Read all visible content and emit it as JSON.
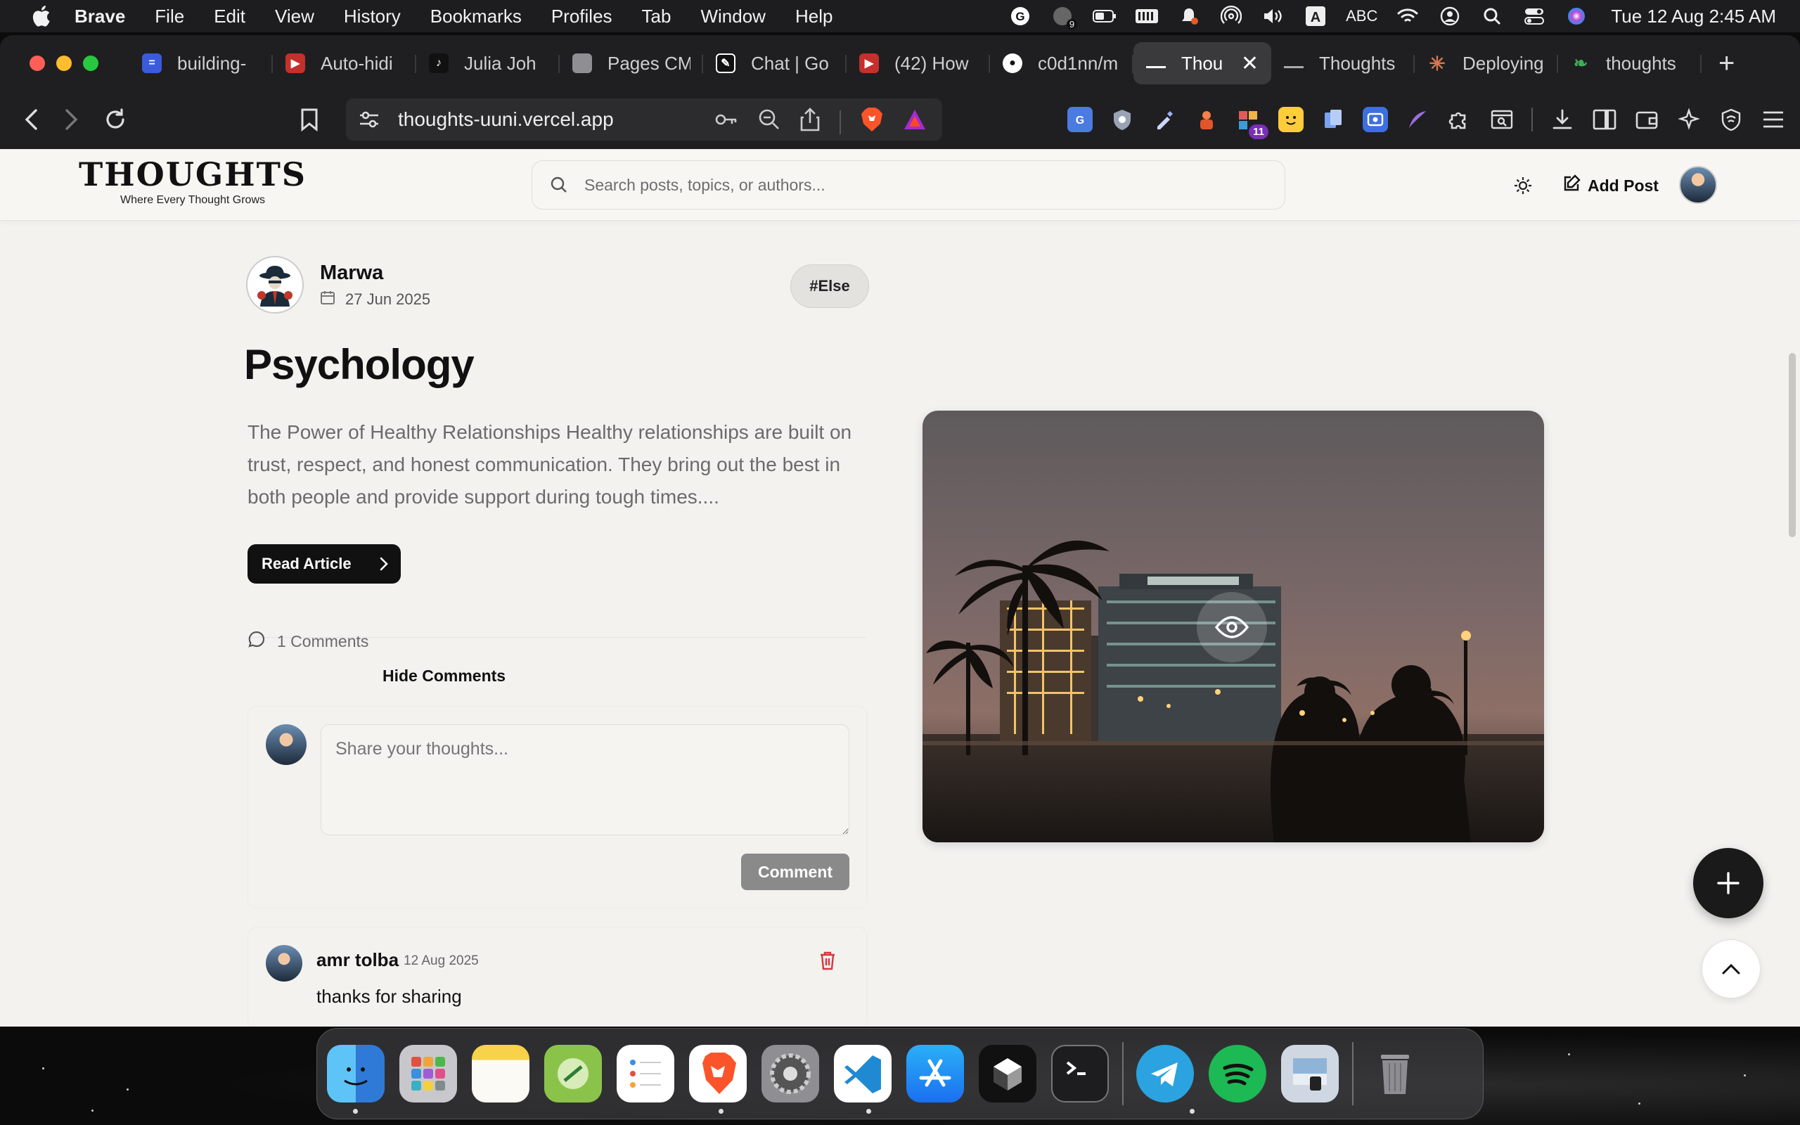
{
  "menubar": {
    "app_name": "Brave",
    "menus": [
      "File",
      "Edit",
      "View",
      "History",
      "Bookmarks",
      "Profiles",
      "Tab",
      "Window",
      "Help"
    ],
    "status": {
      "notifications_badge": "9",
      "input_source": "ABC",
      "clock": "Tue 12 Aug  2:45 AM"
    }
  },
  "tabs": [
    {
      "title": "building-",
      "favicon_color": "#3b5bdb"
    },
    {
      "title": "Auto-hidi",
      "favicon_color": "#c4302b"
    },
    {
      "title": "Julia Joh",
      "favicon_color": "#111111"
    },
    {
      "title": "Pages CM",
      "favicon_color": "#8e8e93"
    },
    {
      "title": "Chat | Go",
      "favicon_color": "#111111"
    },
    {
      "title": "(42) How",
      "favicon_color": "#c4302b"
    },
    {
      "title": "c0d1nn/m",
      "favicon_color": "#111111"
    },
    {
      "title": "Thou",
      "favicon_color": "#111111",
      "active": true
    },
    {
      "title": "Thoughts",
      "favicon_color": "#111111"
    },
    {
      "title": "Deploying",
      "favicon_color": "#d9774f"
    },
    {
      "title": "thoughts",
      "favicon_color": "#3fae5a"
    }
  ],
  "address_bar": {
    "url": "thoughts-uuni.vercel.app"
  },
  "extensions": {
    "badge_count": "11"
  },
  "site": {
    "logo_title": "THOUGHTS",
    "logo_subtitle": "Where Every Thought Grows",
    "search_placeholder": "Search posts, topics, or authors...",
    "add_post_label": "Add Post"
  },
  "post": {
    "author": "Marwa",
    "date": "27 Jun 2025",
    "tag": "#Else",
    "title": "Psychology",
    "excerpt": "The Power of Healthy Relationships Healthy relationships are built on trust, respect, and honest communication. They bring out the best in both people and provide support during tough times....",
    "read_label": "Read Article",
    "comment_count": "1 Comments",
    "hide_comments_label": "Hide Comments",
    "comment_placeholder": "Share your thoughts...",
    "comment_button": "Comment"
  },
  "comments": [
    {
      "author": "amr tolba",
      "date": "12 Aug 2025",
      "text": "thanks for sharing"
    }
  ],
  "dock": {
    "apps": [
      "finder-icon",
      "launchpad-icon",
      "notes-icon",
      "robinhoodie-icon",
      "reminders-icon",
      "brave-icon",
      "system-settings-icon",
      "vscode-icon",
      "app-store-icon",
      "cursor-icon",
      "terminal-icon",
      "telegram-icon",
      "spotify-icon",
      "preview-icon",
      "trash-icon"
    ]
  }
}
